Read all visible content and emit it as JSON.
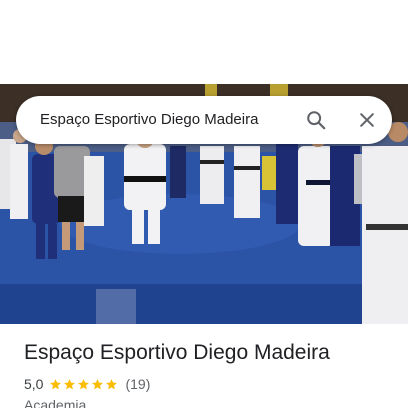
{
  "search": {
    "query": "Espaço Esportivo Diego Madeira",
    "search_icon": "search-icon",
    "close_icon": "close-icon"
  },
  "place": {
    "name": "Espaço Esportivo Diego Madeira",
    "rating": "5,0",
    "stars": 5,
    "reviews": "(19)",
    "category": "Academia"
  },
  "colors": {
    "star": "#fbbc04",
    "title": "#202124",
    "secondary": "#5f6368",
    "mat_blue": "#2c54a8"
  }
}
